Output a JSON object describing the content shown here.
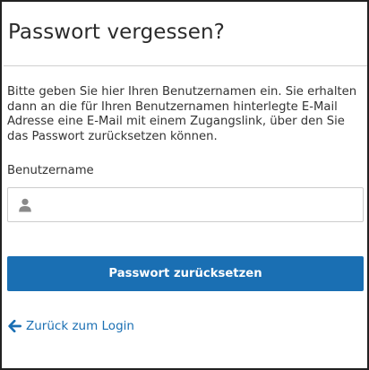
{
  "header": {
    "title": "Passwort vergessen?"
  },
  "main": {
    "description": "Bitte geben Sie hier Ihren Benutzernamen ein. Sie erhalten dann an die für Ihren Benutzernamen hinterlegte E-Mail Adresse eine E-Mail mit einem Zugangslink, über den Sie das Passwort zurücksetzen können.",
    "username_label": "Benutzername",
    "username_value": "",
    "username_placeholder": "",
    "submit_label": "Passwort zurücksetzen",
    "back_link_label": "Zurück zum Login"
  },
  "icons": {
    "input_icon": "user-icon",
    "back_icon": "arrow-left-icon"
  },
  "colors": {
    "accent": "#1a6fb3",
    "text": "#333333",
    "icon_gray": "#8a8a8a",
    "border": "#cccccc"
  }
}
